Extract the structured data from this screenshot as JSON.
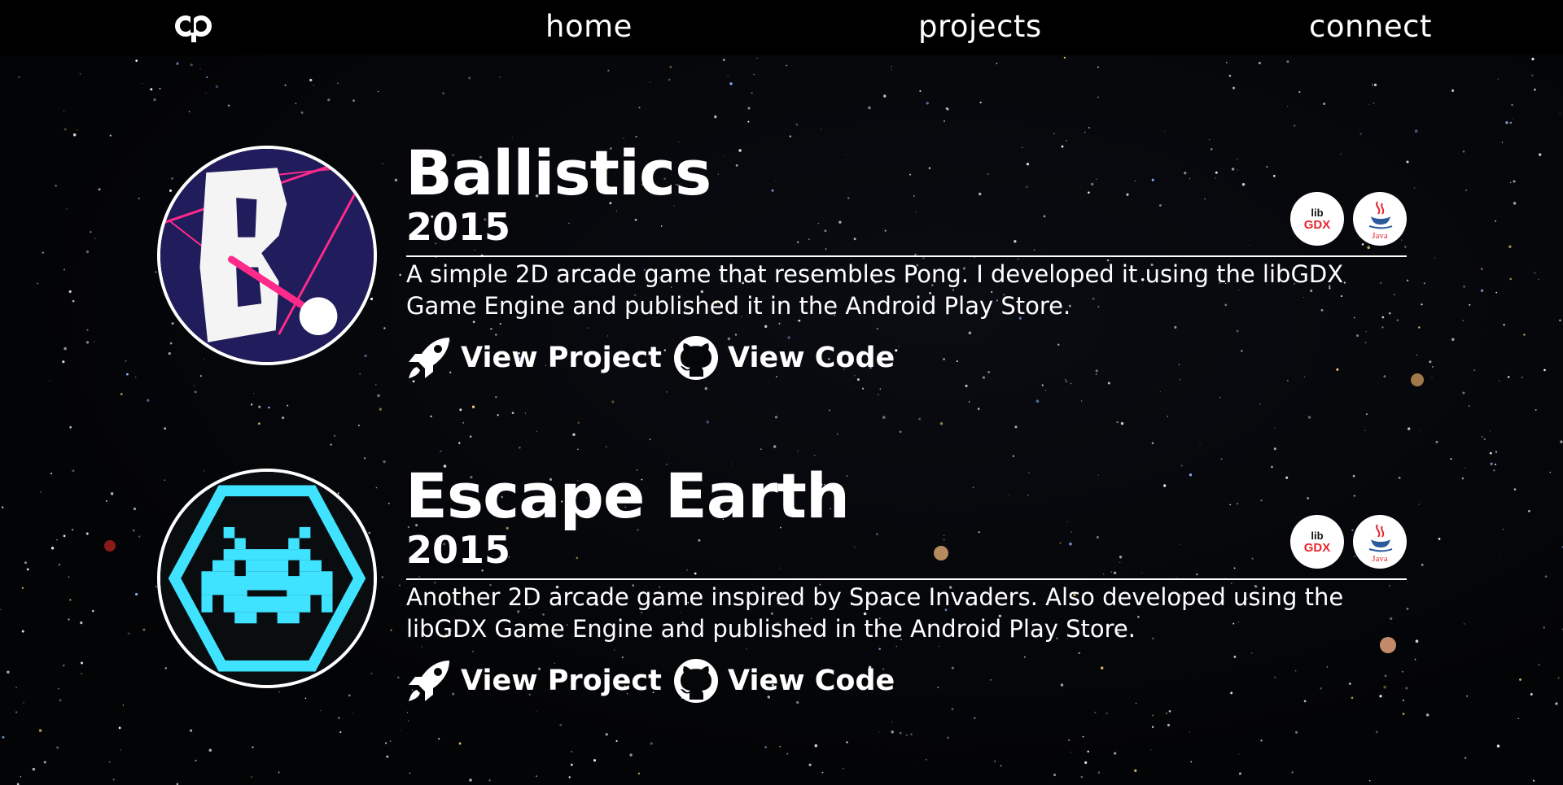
{
  "nav": {
    "logo_icon": "ap-logo-icon",
    "links": [
      {
        "label": "home"
      },
      {
        "label": "projects"
      },
      {
        "label": "connect"
      }
    ]
  },
  "projects": [
    {
      "title": "Ballistics",
      "year": "2015",
      "description": "A simple 2D arcade game that resembles Pong. I developed it using the libGDX Game Engine and published it in the Android Play Store.",
      "view_project_label": "View Project",
      "view_code_label": "View Code",
      "thumbnail_icon": "ballistics-logo-icon",
      "tech": [
        {
          "name": "libGDX",
          "logo_text_top": "lib",
          "logo_text_bottom": "GDX"
        },
        {
          "name": "Java",
          "logo_text": "Java"
        }
      ]
    },
    {
      "title": "Escape Earth",
      "year": "2015",
      "description": "Another 2D arcade game inspired by Space Invaders. Also developed using the libGDX Game Engine and published in the Android Play Store.",
      "view_project_label": "View Project",
      "view_code_label": "View Code",
      "thumbnail_icon": "space-invader-logo-icon",
      "tech": [
        {
          "name": "libGDX",
          "logo_text_top": "lib",
          "logo_text_bottom": "GDX"
        },
        {
          "name": "Java",
          "logo_text": "Java"
        }
      ]
    }
  ],
  "colors": {
    "background": "#050608",
    "text": "#ffffff",
    "ballistics_bg": "#211d5c",
    "ballistics_accent": "#ff2a8a",
    "invader_cyan": "#3fe3ff",
    "libgdx_red": "#e8262e",
    "java_red": "#e3262c"
  }
}
